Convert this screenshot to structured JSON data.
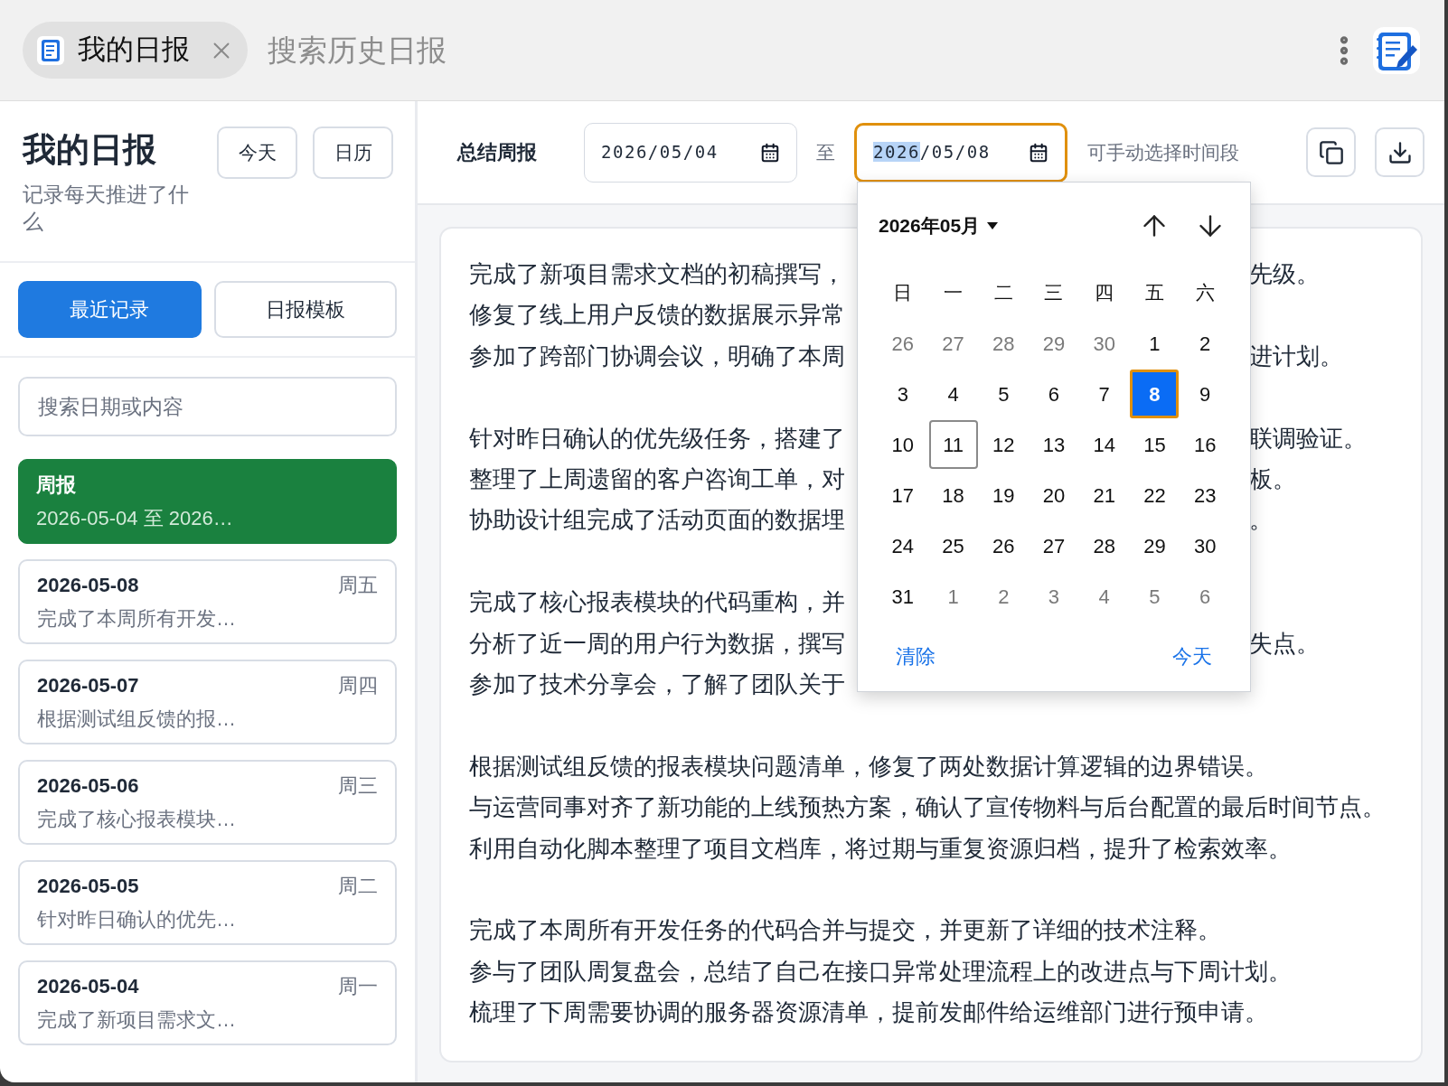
{
  "top_bar": {
    "tab": {
      "title": "我的日报"
    },
    "search": {
      "placeholder": "搜索历史日报"
    }
  },
  "sidebar": {
    "title": "我的日报",
    "subtitle": "记录每天推进了什么",
    "buttons": [
      "今天",
      "日历"
    ],
    "tabs": [
      {
        "label": "最近记录",
        "selected": true
      },
      {
        "label": "日报模板",
        "selected": false
      }
    ],
    "search": {
      "placeholder": "搜索日期或内容"
    },
    "entries": [
      {
        "kind": "weekly",
        "title": "周报",
        "summary": "2026-05-04 至 2026…",
        "selected": true
      },
      {
        "kind": "daily",
        "date": "2026-05-08",
        "weekday": "周五",
        "summary": "完成了本周所有开发…",
        "selected": false
      },
      {
        "kind": "daily",
        "date": "2026-05-07",
        "weekday": "周四",
        "summary": "根据测试组反馈的报…",
        "selected": false
      },
      {
        "kind": "daily",
        "date": "2026-05-06",
        "weekday": "周三",
        "summary": "完成了核心报表模块…",
        "selected": false
      },
      {
        "kind": "daily",
        "date": "2026-05-05",
        "weekday": "周二",
        "summary": "针对昨日确认的优先…",
        "selected": false
      },
      {
        "kind": "daily",
        "date": "2026-05-04",
        "weekday": "周一",
        "summary": "完成了新项目需求文…",
        "selected": false
      }
    ]
  },
  "toolbar": {
    "label": "总结周报",
    "start_date": {
      "value": "2026/05/04",
      "focused": false
    },
    "separator": "至",
    "end_date": {
      "value": "2026/05/08",
      "focused": true
    },
    "hint": "可手动选择时间段"
  },
  "report": {
    "paragraphs": [
      {
        "lines": [
          {
            "left": "完成了新项目需求文档的初稿撰写，",
            "right": "先级。"
          },
          {
            "left": "修复了线上用户反馈的数据展示异常"
          },
          {
            "left": "参加了跨部门协调会议，明确了本周",
            "right": "进计划。"
          }
        ]
      },
      {
        "lines": [
          {
            "left": "针对昨日确认的优先级任务，搭建了",
            "right": "联调验证。"
          },
          {
            "left": "整理了上周遗留的客户咨询工单，对",
            "right": "板。"
          },
          {
            "left": "协助设计组完成了活动页面的数据埋",
            "right": "。"
          }
        ]
      },
      {
        "lines": [
          {
            "left": "完成了核心报表模块的代码重构，并"
          },
          {
            "left": "分析了近一周的用户行为数据，撰写",
            "right": "失点。"
          },
          {
            "left": "参加了技术分享会，了解了团队关于"
          }
        ]
      },
      {
        "lines": [
          {
            "text": "根据测试组反馈的报表模块问题清单，修复了两处数据计算逻辑的边界错误。"
          },
          {
            "text": "与运营同事对齐了新功能的上线预热方案，确认了宣传物料与后台配置的最后时间节点。"
          },
          {
            "text": "利用自动化脚本整理了项目文档库，将过期与重复资源归档，提升了检索效率。"
          }
        ]
      },
      {
        "lines": [
          {
            "text": "完成了本周所有开发任务的代码合并与提交，并更新了详细的技术注释。"
          },
          {
            "text": "参与了团队周复盘会，总结了自己在接口异常处理流程上的改进点与下周计划。"
          },
          {
            "text": "梳理了下周需要协调的服务器资源清单，提前发邮件给运维部门进行预申请。"
          }
        ]
      }
    ]
  },
  "date_picker": {
    "month_label": "2026年05月",
    "weekdays": [
      "日",
      "一",
      "二",
      "三",
      "四",
      "五",
      "六"
    ],
    "days": [
      {
        "day": "26",
        "outside": true,
        "selected": false,
        "today": false
      },
      {
        "day": "27",
        "outside": true,
        "selected": false,
        "today": false
      },
      {
        "day": "28",
        "outside": true,
        "selected": false,
        "today": false
      },
      {
        "day": "29",
        "outside": true,
        "selected": false,
        "today": false
      },
      {
        "day": "30",
        "outside": true,
        "selected": false,
        "today": false
      },
      {
        "day": "1",
        "outside": false,
        "selected": false,
        "today": false
      },
      {
        "day": "2",
        "outside": false,
        "selected": false,
        "today": false
      },
      {
        "day": "3",
        "outside": false,
        "selected": false,
        "today": false
      },
      {
        "day": "4",
        "outside": false,
        "selected": false,
        "today": false
      },
      {
        "day": "5",
        "outside": false,
        "selected": false,
        "today": false
      },
      {
        "day": "6",
        "outside": false,
        "selected": false,
        "today": false
      },
      {
        "day": "7",
        "outside": false,
        "selected": false,
        "today": false
      },
      {
        "day": "8",
        "outside": false,
        "selected": true,
        "today": false
      },
      {
        "day": "9",
        "outside": false,
        "selected": false,
        "today": false
      },
      {
        "day": "10",
        "outside": false,
        "selected": false,
        "today": false
      },
      {
        "day": "11",
        "outside": false,
        "selected": false,
        "today": true
      },
      {
        "day": "12",
        "outside": false,
        "selected": false,
        "today": false
      },
      {
        "day": "13",
        "outside": false,
        "selected": false,
        "today": false
      },
      {
        "day": "14",
        "outside": false,
        "selected": false,
        "today": false
      },
      {
        "day": "15",
        "outside": false,
        "selected": false,
        "today": false
      },
      {
        "day": "16",
        "outside": false,
        "selected": false,
        "today": false
      },
      {
        "day": "17",
        "outside": false,
        "selected": false,
        "today": false
      },
      {
        "day": "18",
        "outside": false,
        "selected": false,
        "today": false
      },
      {
        "day": "19",
        "outside": false,
        "selected": false,
        "today": false
      },
      {
        "day": "20",
        "outside": false,
        "selected": false,
        "today": false
      },
      {
        "day": "21",
        "outside": false,
        "selected": false,
        "today": false
      },
      {
        "day": "22",
        "outside": false,
        "selected": false,
        "today": false
      },
      {
        "day": "23",
        "outside": false,
        "selected": false,
        "today": false
      },
      {
        "day": "24",
        "outside": false,
        "selected": false,
        "today": false
      },
      {
        "day": "25",
        "outside": false,
        "selected": false,
        "today": false
      },
      {
        "day": "26",
        "outside": false,
        "selected": false,
        "today": false
      },
      {
        "day": "27",
        "outside": false,
        "selected": false,
        "today": false
      },
      {
        "day": "28",
        "outside": false,
        "selected": false,
        "today": false
      },
      {
        "day": "29",
        "outside": false,
        "selected": false,
        "today": false
      },
      {
        "day": "30",
        "outside": false,
        "selected": false,
        "today": false
      },
      {
        "day": "31",
        "outside": false,
        "selected": false,
        "today": false
      },
      {
        "day": "1",
        "outside": true,
        "selected": false,
        "today": false
      },
      {
        "day": "2",
        "outside": true,
        "selected": false,
        "today": false
      },
      {
        "day": "3",
        "outside": true,
        "selected": false,
        "today": false
      },
      {
        "day": "4",
        "outside": true,
        "selected": false,
        "today": false
      },
      {
        "day": "5",
        "outside": true,
        "selected": false,
        "today": false
      },
      {
        "day": "6",
        "outside": true,
        "selected": false,
        "today": false
      }
    ],
    "clear": "清除",
    "today": "今天"
  }
}
